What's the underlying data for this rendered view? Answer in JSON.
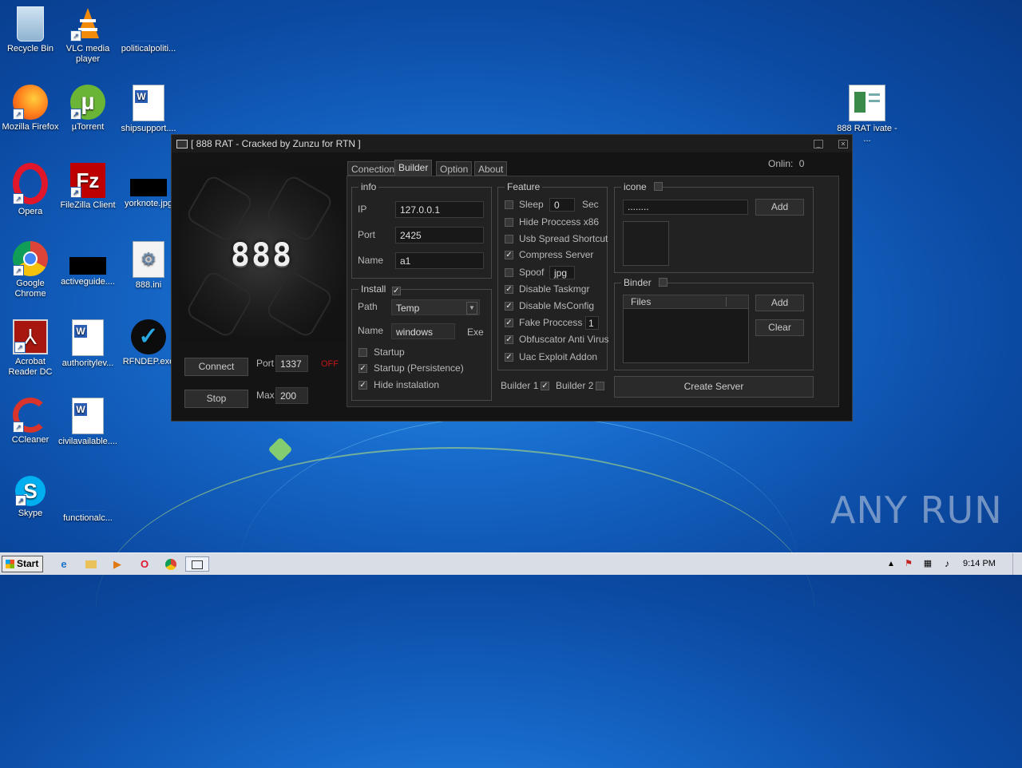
{
  "desktop": {
    "icons": [
      {
        "label": "Recycle Bin"
      },
      {
        "label": "VLC media player"
      },
      {
        "label": "politicalpoliti..."
      },
      {
        "label": "Mozilla Firefox"
      },
      {
        "label": "µTorrent"
      },
      {
        "label": "shipsupport...."
      },
      {
        "label": "Opera"
      },
      {
        "label": "FileZilla Client"
      },
      {
        "label": "yorknote.jpg"
      },
      {
        "label": "Google Chrome"
      },
      {
        "label": "activeguide...."
      },
      {
        "label": "888.ini"
      },
      {
        "label": "Acrobat Reader DC"
      },
      {
        "label": "authoritylev..."
      },
      {
        "label": "RFNDEP.exe"
      },
      {
        "label": "CCleaner"
      },
      {
        "label": "civilavailable...."
      },
      {
        "label": "Skype"
      },
      {
        "label": "functionalc..."
      },
      {
        "label": "888 RAT ivate - ..."
      }
    ]
  },
  "window": {
    "title": "[ 888 RAT - Cracked by Zunzu for RTN ]",
    "logo_text": "888",
    "online_label": "Onlin:",
    "online_count": "0",
    "left": {
      "connect_label": "Connect",
      "stop_label": "Stop",
      "port_label": "Port",
      "port_value": "1337",
      "status_text": "OFF",
      "max_label": "Max",
      "max_value": "200"
    },
    "tabs": [
      "Conection",
      "Builder",
      "Option",
      "About"
    ],
    "active_tab": "Builder",
    "builder": {
      "info": {
        "title": "info",
        "ip_label": "IP",
        "ip_value": "127.0.0.1",
        "port_label": "Port",
        "port_value": "2425",
        "name_label": "Name",
        "name_value": "a1"
      },
      "install": {
        "title": "Install",
        "checked": true,
        "path_label": "Path",
        "path_value": "Temp",
        "name_label": "Name",
        "name_value": "windows",
        "ext_label": "Exe",
        "options": [
          {
            "label": "Startup",
            "checked": false
          },
          {
            "label": "Startup (Persistence)",
            "checked": true
          },
          {
            "label": "Hide instalation",
            "checked": true
          }
        ]
      },
      "feature": {
        "title": "Feature",
        "sleep_label": "Sleep",
        "sleep_value": "0",
        "sleep_unit": "Sec",
        "spoof_label": "Spoof",
        "spoof_value": "jpg",
        "fake_label": "Fake Proccess",
        "fake_value": "1",
        "options": [
          {
            "label": "Sleep",
            "checked": false
          },
          {
            "label": "Hide Proccess x86",
            "checked": false
          },
          {
            "label": "Usb Spread Shortcut",
            "checked": false
          },
          {
            "label": "Compress Server",
            "checked": true
          },
          {
            "label": "Spoof",
            "checked": false
          },
          {
            "label": "Disable Taskmgr",
            "checked": true
          },
          {
            "label": "Disable MsConfig",
            "checked": true
          },
          {
            "label": "Fake Proccess",
            "checked": true
          },
          {
            "label": "Obfuscator Anti Virus",
            "checked": true
          },
          {
            "label": "Uac Exploit Addon",
            "checked": true
          }
        ]
      },
      "builder1_label": "Builder 1",
      "builder1_checked": true,
      "builder2_label": "Builder 2",
      "builder2_checked": false,
      "icone": {
        "title": "icone",
        "path_value": "........",
        "add_label": "Add"
      },
      "binder": {
        "title": "Binder",
        "column_files": "Files",
        "add_label": "Add",
        "clear_label": "Clear"
      },
      "create_label": "Create Server"
    }
  },
  "taskbar": {
    "start_label": "Start",
    "clock": "9:14 PM"
  },
  "watermark": "ANY RUN"
}
